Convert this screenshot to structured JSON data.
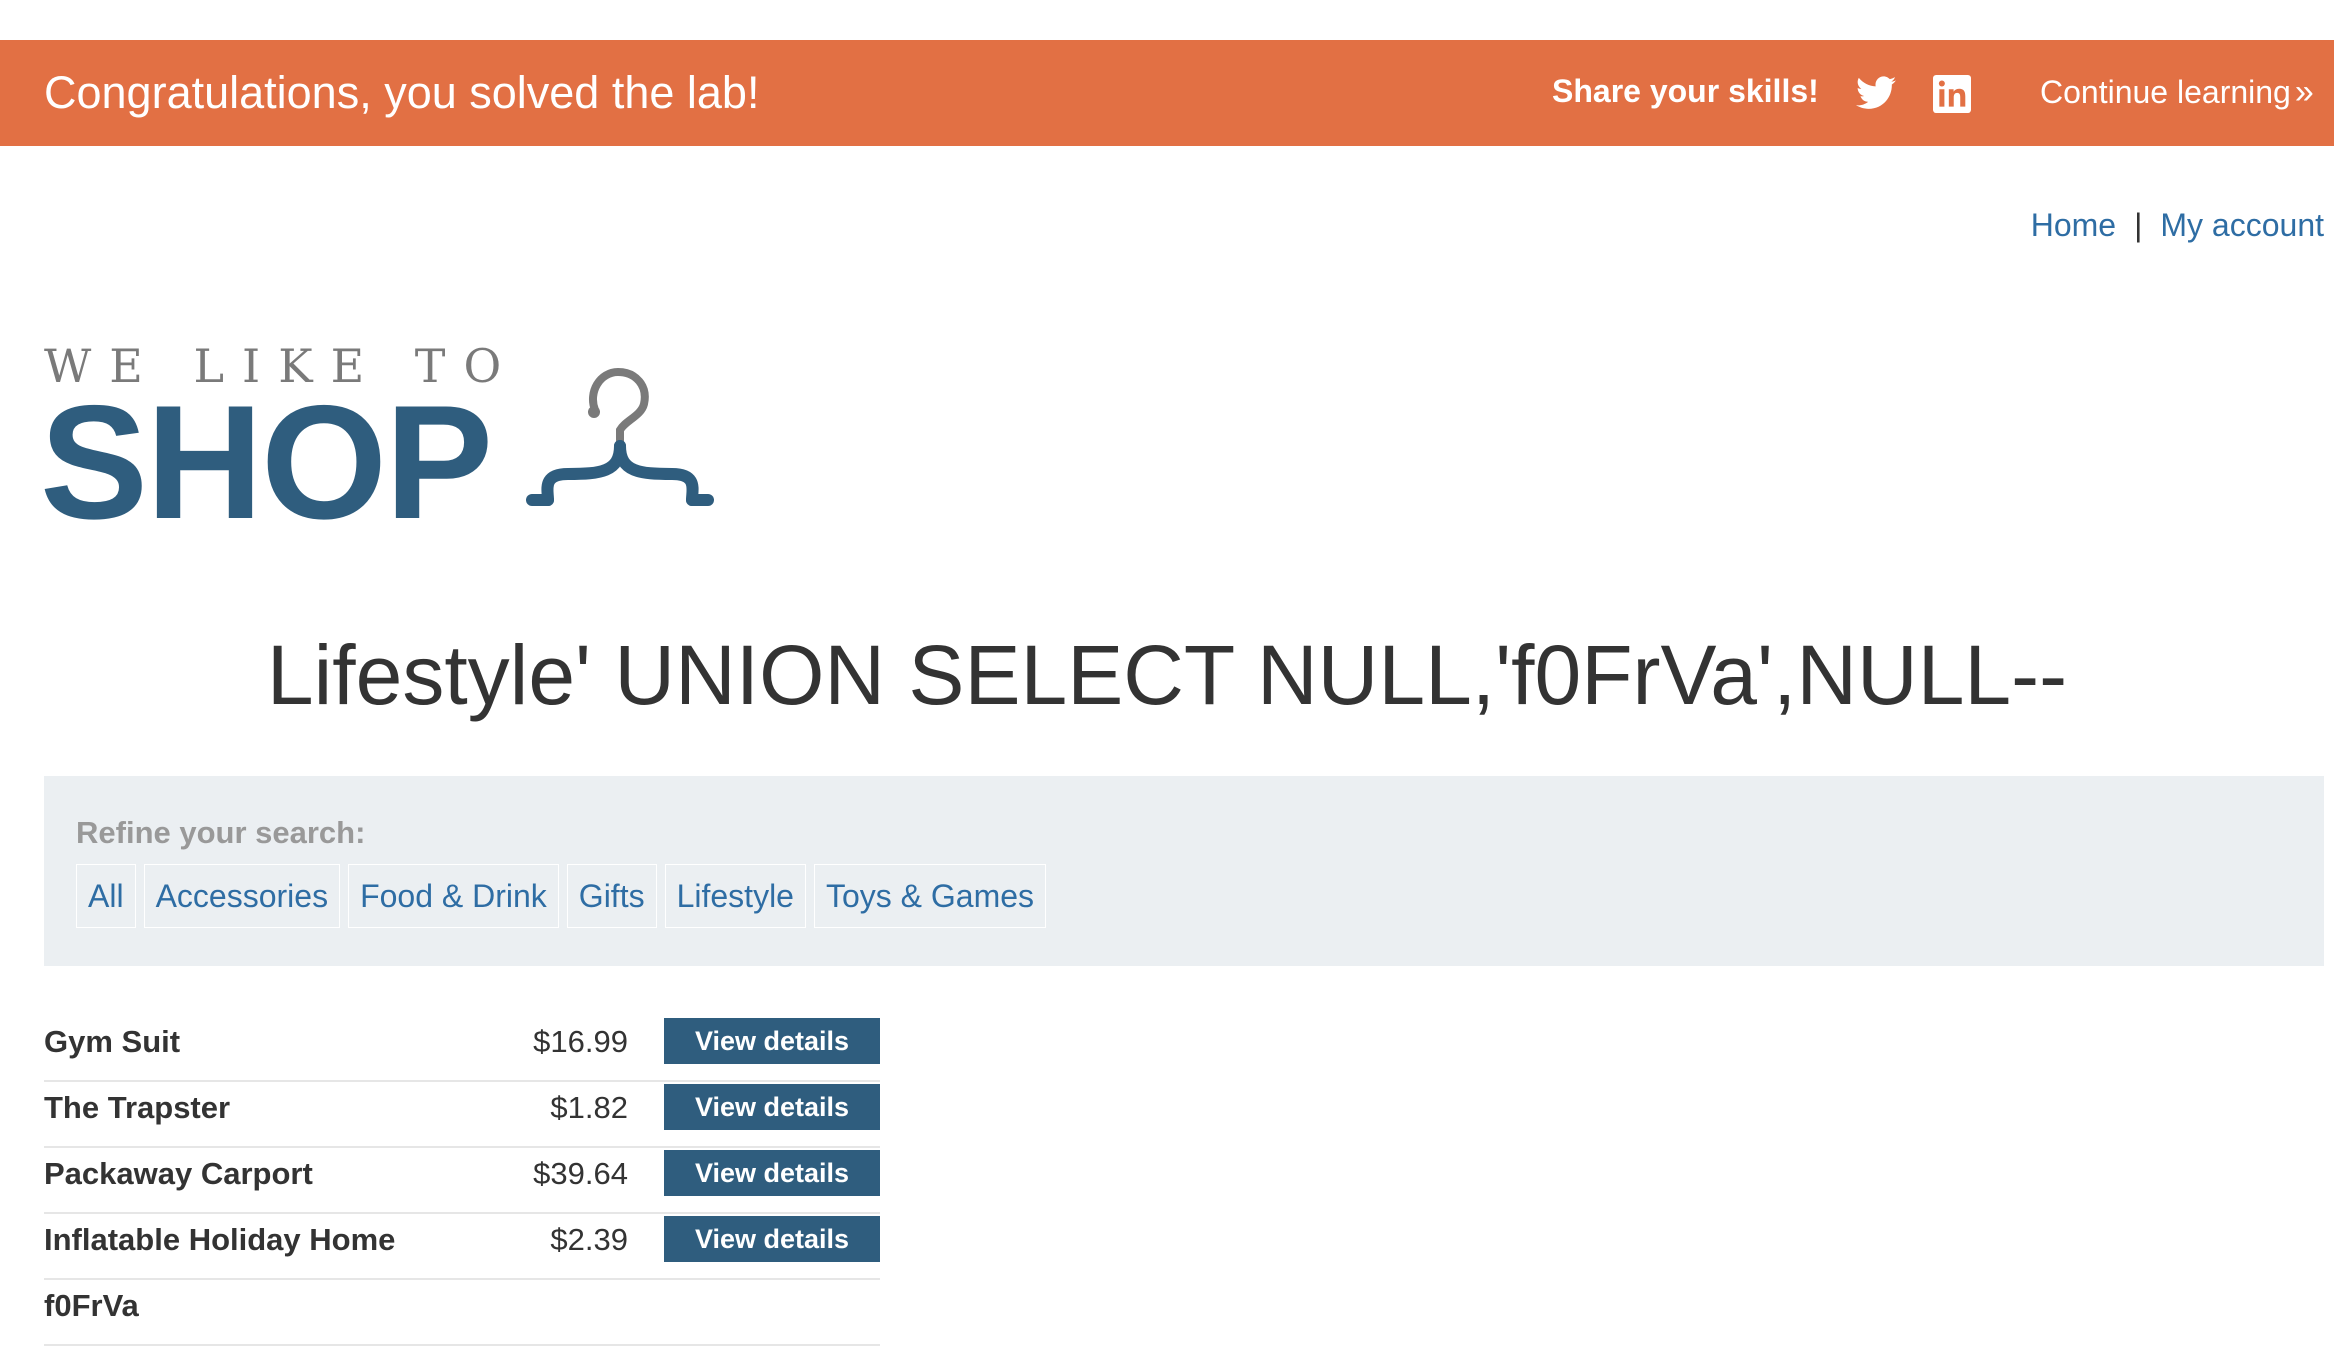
{
  "banner": {
    "title": "Congratulations, you solved the lab!",
    "share_label": "Share your skills!",
    "continue_label": "Continue learning",
    "color": "#e27044"
  },
  "nav": {
    "home": "Home",
    "separator": "|",
    "account": "My account"
  },
  "logo": {
    "tagline": "WE LIKE TO",
    "brand": "SHOP",
    "icon": "hanger-icon"
  },
  "heading": "Lifestyle' UNION SELECT NULL,'f0FrVa',NULL--",
  "filter": {
    "label": "Refine your search:",
    "categories": [
      "All",
      "Accessories",
      "Food & Drink",
      "Gifts",
      "Lifestyle",
      "Toys & Games"
    ]
  },
  "products": [
    {
      "name": "Gym Suit",
      "price": "$16.99",
      "action": "View details"
    },
    {
      "name": "The Trapster",
      "price": "$1.82",
      "action": "View details"
    },
    {
      "name": "Packaway Carport",
      "price": "$39.64",
      "action": "View details"
    },
    {
      "name": "Inflatable Holiday Home",
      "price": "$2.39",
      "action": "View details"
    },
    {
      "name": "f0FrVa",
      "price": "",
      "action": ""
    }
  ],
  "colors": {
    "accent": "#e27044",
    "brand": "#2f5d7e",
    "link": "#2e6da4"
  }
}
